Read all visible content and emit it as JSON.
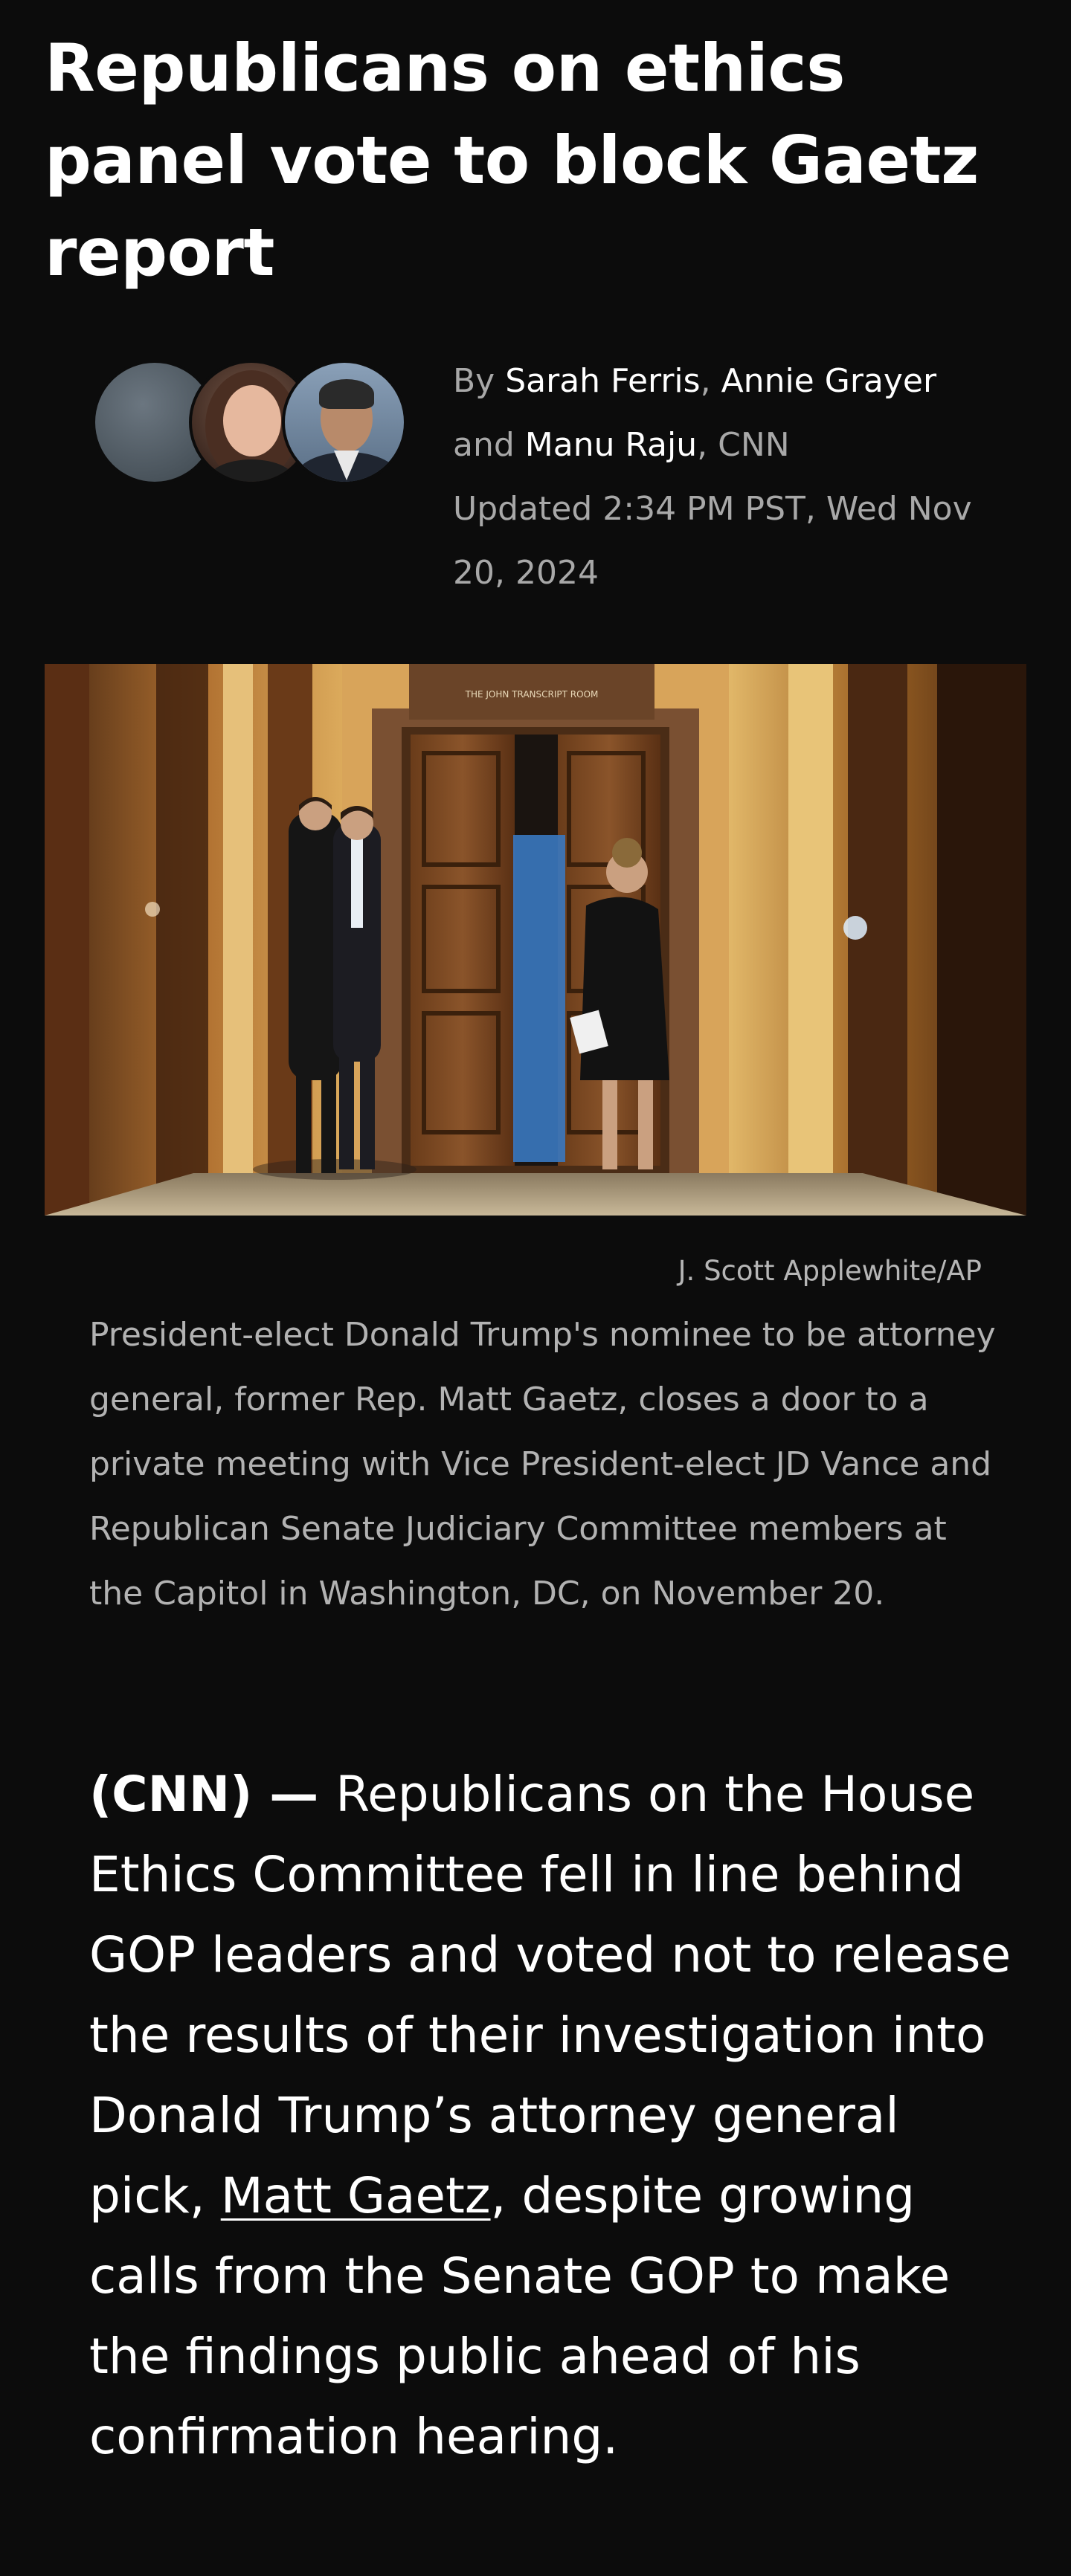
{
  "article": {
    "headline": "Republicans on ethics panel vote to block Gaetz report",
    "byline": {
      "prefix": "By",
      "authors": [
        "Sarah Ferris",
        "Annie Grayer",
        "Manu Raju"
      ],
      "sep1": ", ",
      "sep2": " and ",
      "outlet": ", CNN",
      "updated": "Updated 2:34 PM PST, Wed Nov 20, 2024"
    },
    "image": {
      "credit": "J. Scott Applewhite/AP",
      "sign_text": "THE JOHN TRANSCRIPT ROOM",
      "caption": "President-elect Donald Trump's nominee to be attorney general, former Rep. Matt Gaetz, closes a door to a private meeting with Vice President-elect JD Vance and Republican Senate Judiciary Committee members at the Capitol in Washington, DC, on November 20."
    },
    "body": {
      "source": "(CNN)",
      "dash": " — ",
      "text_before_link": "Republicans on the House Ethics Committee fell in line behind GOP leaders and voted not to release the results of their investigation into Donald Trump’s attorney general pick, ",
      "link_text": "Matt Gaetz",
      "text_after_link": ", despite growing calls from the Senate GOP to make the findings public ahead of his confirmation hearing."
    }
  }
}
